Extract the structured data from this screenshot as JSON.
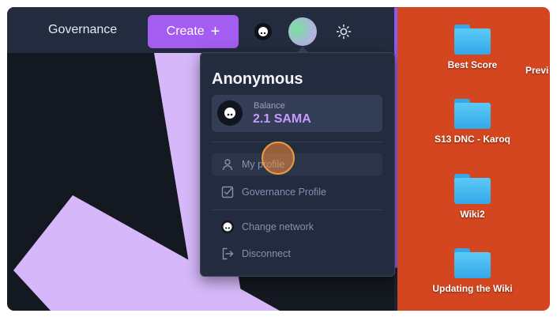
{
  "header": {
    "nav_governance": "Governance",
    "create_label": "Create",
    "create_icon": "plus-icon",
    "theme_icon": "sun-icon"
  },
  "dropdown": {
    "title": "Anonymous",
    "balance_label": "Balance",
    "balance_value": "2.1 SAMA",
    "items": [
      {
        "label": "My profile",
        "icon": "user-icon"
      },
      {
        "label": "Governance Profile",
        "icon": "checkbox-icon"
      },
      {
        "label": "Change network",
        "icon": "network-icon"
      },
      {
        "label": "Disconnect",
        "icon": "logout-icon"
      }
    ]
  },
  "desktop": {
    "items": [
      {
        "label": "Best Score"
      },
      {
        "label": "S13 DNC - Karoq"
      },
      {
        "label": "Wiki2"
      },
      {
        "label": "Updating the Wiki"
      }
    ],
    "edge_label": "Previ"
  },
  "colors": {
    "accent": "#a55cf0",
    "balance": "#c69bff",
    "desktop_bg": "#d4461f",
    "shape": "#d6b8fa"
  }
}
